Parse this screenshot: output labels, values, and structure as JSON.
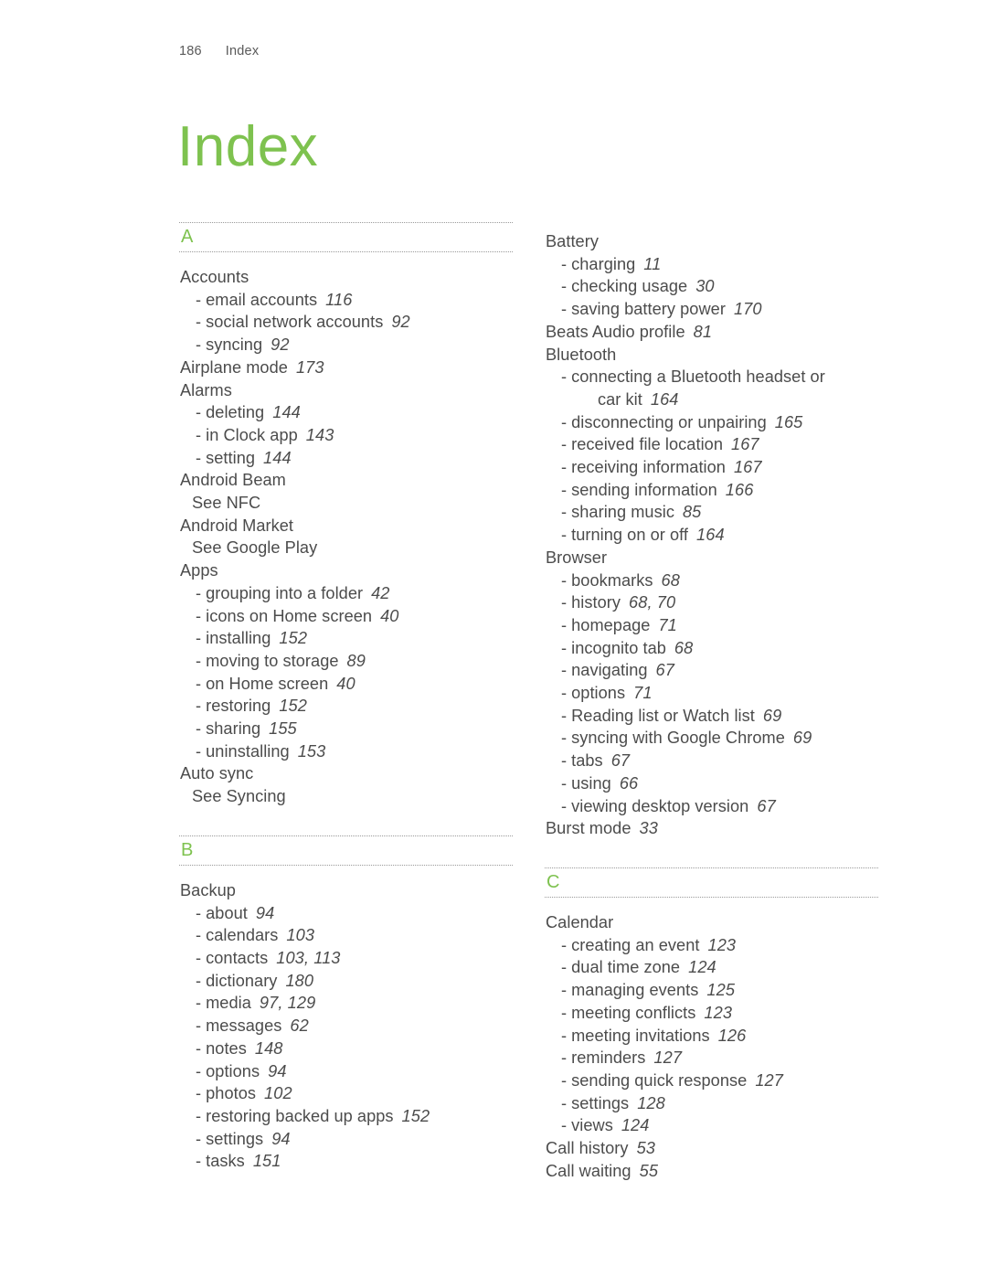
{
  "header": {
    "page_number": "186",
    "section_label": "Index"
  },
  "title": "Index",
  "colors": {
    "accent_green": "#7ec24f",
    "body_text": "#4c4c4c",
    "rule": "#9a9a9a"
  },
  "columns": [
    {
      "id": "left-column",
      "sections": [
        {
          "letter": "A",
          "entries": [
            {
              "type": "main",
              "text": "Accounts",
              "pages": ""
            },
            {
              "type": "sub",
              "text": "email accounts",
              "pages": "116"
            },
            {
              "type": "sub",
              "text": "social network accounts",
              "pages": "92"
            },
            {
              "type": "sub",
              "text": "syncing",
              "pages": "92"
            },
            {
              "type": "main",
              "text": "Airplane mode",
              "pages": "173"
            },
            {
              "type": "main",
              "text": "Alarms",
              "pages": ""
            },
            {
              "type": "sub",
              "text": "deleting",
              "pages": "144"
            },
            {
              "type": "sub",
              "text": "in Clock app",
              "pages": "143"
            },
            {
              "type": "sub",
              "text": "setting",
              "pages": "144"
            },
            {
              "type": "main",
              "text": "Android Beam",
              "pages": ""
            },
            {
              "type": "see",
              "text": "See NFC",
              "pages": ""
            },
            {
              "type": "main",
              "text": "Android Market",
              "pages": ""
            },
            {
              "type": "see",
              "text": "See Google Play",
              "pages": ""
            },
            {
              "type": "main",
              "text": "Apps",
              "pages": ""
            },
            {
              "type": "sub",
              "text": "grouping into a folder",
              "pages": "42"
            },
            {
              "type": "sub",
              "text": "icons on Home screen",
              "pages": "40"
            },
            {
              "type": "sub",
              "text": "installing",
              "pages": "152"
            },
            {
              "type": "sub",
              "text": "moving to storage",
              "pages": "89"
            },
            {
              "type": "sub",
              "text": "on Home screen",
              "pages": "40"
            },
            {
              "type": "sub",
              "text": "restoring",
              "pages": "152"
            },
            {
              "type": "sub",
              "text": "sharing",
              "pages": "155"
            },
            {
              "type": "sub",
              "text": "uninstalling",
              "pages": "153"
            },
            {
              "type": "main",
              "text": "Auto sync",
              "pages": ""
            },
            {
              "type": "see",
              "text": "See Syncing",
              "pages": ""
            }
          ]
        },
        {
          "letter": "B",
          "entries": [
            {
              "type": "main",
              "text": "Backup",
              "pages": ""
            },
            {
              "type": "sub",
              "text": "about",
              "pages": "94"
            },
            {
              "type": "sub",
              "text": "calendars",
              "pages": "103"
            },
            {
              "type": "sub",
              "text": "contacts",
              "pages": "103, 113"
            },
            {
              "type": "sub",
              "text": "dictionary",
              "pages": "180"
            },
            {
              "type": "sub",
              "text": "media",
              "pages": "97, 129"
            },
            {
              "type": "sub",
              "text": "messages",
              "pages": "62"
            },
            {
              "type": "sub",
              "text": "notes",
              "pages": "148"
            },
            {
              "type": "sub",
              "text": "options",
              "pages": "94"
            },
            {
              "type": "sub",
              "text": "photos",
              "pages": "102"
            },
            {
              "type": "sub",
              "text": "restoring backed up apps",
              "pages": "152"
            },
            {
              "type": "sub",
              "text": "settings",
              "pages": "94"
            },
            {
              "type": "sub",
              "text": "tasks",
              "pages": "151"
            }
          ]
        }
      ]
    },
    {
      "id": "right-column",
      "sections": [
        {
          "letter": "",
          "entries": [
            {
              "type": "main",
              "text": "Battery",
              "pages": ""
            },
            {
              "type": "sub",
              "text": "charging",
              "pages": "11"
            },
            {
              "type": "sub",
              "text": "checking usage",
              "pages": "30"
            },
            {
              "type": "sub",
              "text": "saving battery power",
              "pages": "170"
            },
            {
              "type": "main",
              "text": "Beats Audio profile",
              "pages": "81"
            },
            {
              "type": "main",
              "text": "Bluetooth",
              "pages": ""
            },
            {
              "type": "sub",
              "text": "connecting a Bluetooth headset or",
              "pages": ""
            },
            {
              "type": "cont",
              "text": "car kit",
              "pages": "164"
            },
            {
              "type": "sub",
              "text": "disconnecting or unpairing",
              "pages": "165"
            },
            {
              "type": "sub",
              "text": "received file location",
              "pages": "167"
            },
            {
              "type": "sub",
              "text": "receiving information",
              "pages": "167"
            },
            {
              "type": "sub",
              "text": "sending information",
              "pages": "166"
            },
            {
              "type": "sub",
              "text": "sharing music",
              "pages": "85"
            },
            {
              "type": "sub",
              "text": "turning on or off",
              "pages": "164"
            },
            {
              "type": "main",
              "text": "Browser",
              "pages": ""
            },
            {
              "type": "sub",
              "text": "bookmarks",
              "pages": "68"
            },
            {
              "type": "sub",
              "text": "history",
              "pages": "68, 70"
            },
            {
              "type": "sub",
              "text": "homepage",
              "pages": "71"
            },
            {
              "type": "sub",
              "text": "incognito tab",
              "pages": "68"
            },
            {
              "type": "sub",
              "text": "navigating",
              "pages": "67"
            },
            {
              "type": "sub",
              "text": "options",
              "pages": "71"
            },
            {
              "type": "sub",
              "text": "Reading list or Watch list",
              "pages": "69"
            },
            {
              "type": "sub",
              "text": "syncing with Google Chrome",
              "pages": "69"
            },
            {
              "type": "sub",
              "text": "tabs",
              "pages": "67"
            },
            {
              "type": "sub",
              "text": "using",
              "pages": "66"
            },
            {
              "type": "sub",
              "text": "viewing desktop version",
              "pages": "67"
            },
            {
              "type": "main",
              "text": "Burst mode",
              "pages": "33"
            }
          ]
        },
        {
          "letter": "C",
          "entries": [
            {
              "type": "main",
              "text": "Calendar",
              "pages": ""
            },
            {
              "type": "sub",
              "text": "creating an event",
              "pages": "123"
            },
            {
              "type": "sub",
              "text": "dual time zone",
              "pages": "124"
            },
            {
              "type": "sub",
              "text": "managing events",
              "pages": "125"
            },
            {
              "type": "sub",
              "text": "meeting conflicts",
              "pages": "123"
            },
            {
              "type": "sub",
              "text": "meeting invitations",
              "pages": "126"
            },
            {
              "type": "sub",
              "text": "reminders",
              "pages": "127"
            },
            {
              "type": "sub",
              "text": "sending quick response",
              "pages": "127"
            },
            {
              "type": "sub",
              "text": "settings",
              "pages": "128"
            },
            {
              "type": "sub",
              "text": "views",
              "pages": "124"
            },
            {
              "type": "main",
              "text": "Call history",
              "pages": "53"
            },
            {
              "type": "main",
              "text": "Call waiting",
              "pages": "55"
            }
          ]
        }
      ]
    }
  ]
}
